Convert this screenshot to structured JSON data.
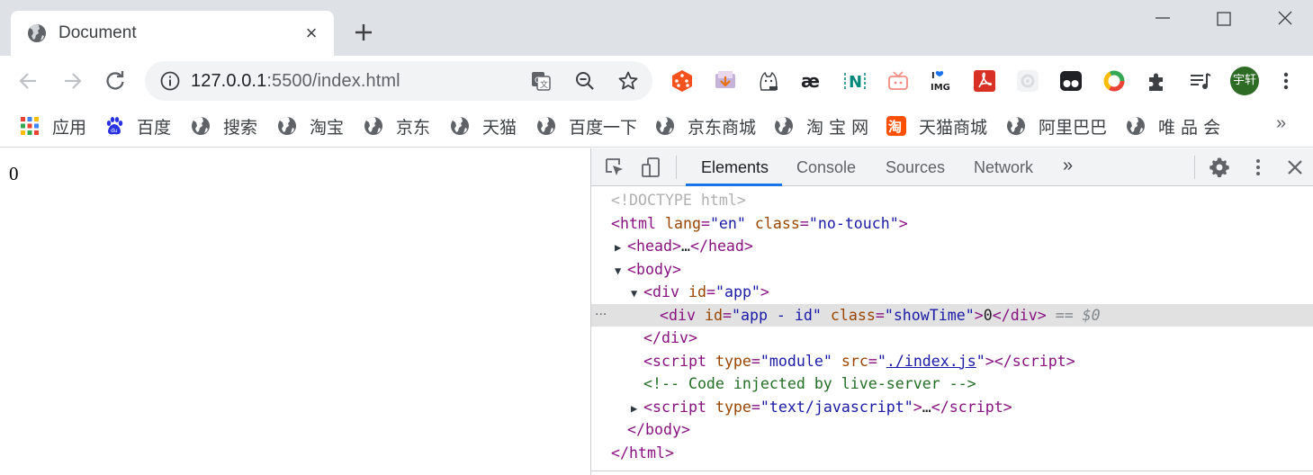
{
  "tab": {
    "title": "Document",
    "close": "×"
  },
  "window": {
    "minimize": "minimize",
    "maximize": "maximize",
    "close": "close"
  },
  "address": {
    "host": "127.0.0.1",
    "path": ":5500/index.html"
  },
  "profile": {
    "initials": "宇轩"
  },
  "bookmarks": [
    {
      "label": "应用",
      "icon": "apps-grid-icon"
    },
    {
      "label": "百度",
      "icon": "baidu-paw-icon"
    },
    {
      "label": "搜索",
      "icon": "globe-icon"
    },
    {
      "label": "淘宝",
      "icon": "globe-icon"
    },
    {
      "label": "京东",
      "icon": "globe-icon"
    },
    {
      "label": "天猫",
      "icon": "globe-icon"
    },
    {
      "label": "百度一下",
      "icon": "globe-icon"
    },
    {
      "label": "京东商城",
      "icon": "globe-icon"
    },
    {
      "label": "淘 宝 网",
      "icon": "globe-icon"
    },
    {
      "label": "天猫商城",
      "icon": "tao-logo-icon"
    },
    {
      "label": "阿里巴巴",
      "icon": "globe-icon"
    },
    {
      "label": "唯 品 会",
      "icon": "globe-icon"
    }
  ],
  "bookmarks_more": "»",
  "page": {
    "content": "0"
  },
  "devtools": {
    "tabs": [
      "Elements",
      "Console",
      "Sources",
      "Network"
    ],
    "more_tabs": "»",
    "dom": {
      "doctype": "<!DOCTYPE html>",
      "html_open_tag": "html",
      "html_attr_lang": "lang",
      "html_lang_val": "\"en\"",
      "html_attr_class": "class",
      "html_class_val": "\"no-touch\"",
      "head_tag": "head",
      "head_ellipsis": "…",
      "body_tag": "body",
      "div_tag": "div",
      "app_attr": "id",
      "app_val": "\"app\"",
      "sel_attr_id": "id",
      "sel_id_val": "\"app - id\"",
      "sel_attr_class": "class",
      "sel_class_val": "\"showTime\"",
      "sel_text": "0",
      "sel_eq": "== $0",
      "script_tag": "script",
      "script_attr_type": "type",
      "script_type_val": "\"module\"",
      "script_attr_src": "src",
      "script_src_val": "./index.js",
      "comment": "<!-- Code injected by live-server -->",
      "script2_type_val": "\"text/javascript\"",
      "script2_ellipsis": "…",
      "selected_gutter": "···"
    }
  },
  "colors": {
    "accent": "#1a73e8",
    "tabstrip": "#dee1e6",
    "avatar": "#2e6b25"
  }
}
